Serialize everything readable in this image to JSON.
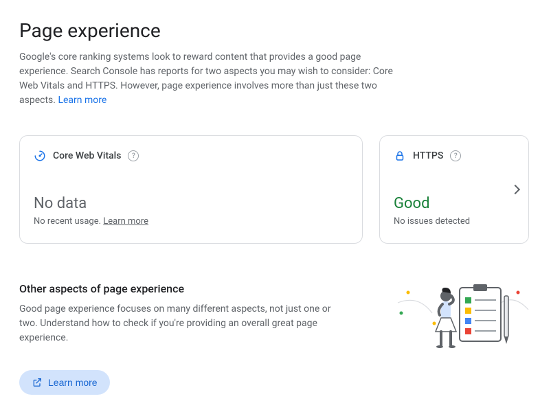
{
  "header": {
    "title": "Page experience",
    "description": "Google's core ranking systems look to reward content that provides a good page experience. Search Console has reports for two aspects you may wish to consider: Core Web Vitals and HTTPS. However, page experience involves more than just these two aspects. ",
    "learn_more": "Learn more"
  },
  "cards": {
    "cwv": {
      "title": "Core Web Vitals",
      "status": "No data",
      "sub_prefix": "No recent usage. ",
      "sub_link": "Learn more"
    },
    "https": {
      "title": "HTTPS",
      "status": "Good",
      "sub": "No issues detected"
    }
  },
  "other": {
    "title": "Other aspects of page experience",
    "description": "Good page experience focuses on many different aspects, not just one or two. Understand how to check if you're providing an overall great page experience.",
    "button": "Learn more"
  }
}
